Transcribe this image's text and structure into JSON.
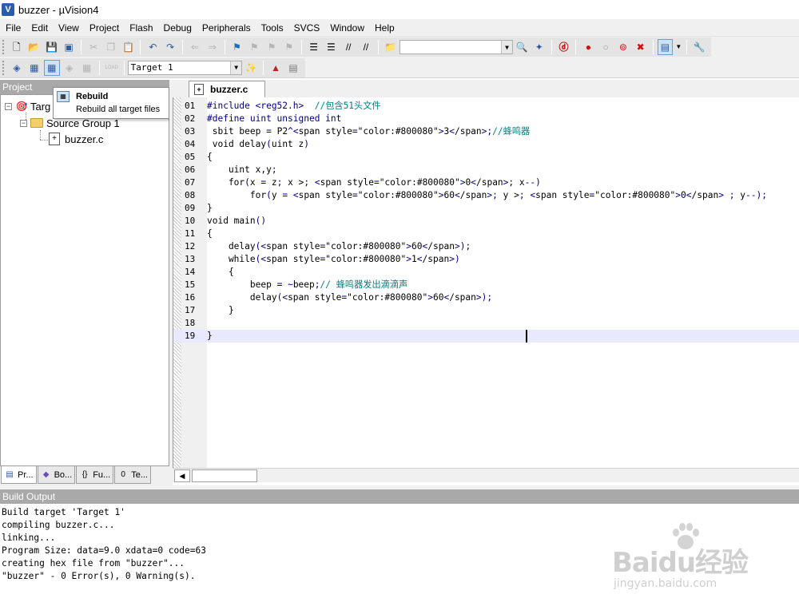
{
  "window": {
    "title": "buzzer  - µVision4"
  },
  "menu": [
    "File",
    "Edit",
    "View",
    "Project",
    "Flash",
    "Debug",
    "Peripherals",
    "Tools",
    "SVCS",
    "Window",
    "Help"
  ],
  "toolbar2": {
    "target_select": "Target 1",
    "load_label": "LOAD"
  },
  "project_panel": {
    "title": "Project",
    "target_label": "Targ",
    "group_label": "Source Group 1",
    "file_label": "buzzer.c",
    "tabs": [
      "Pr...",
      "Bo...",
      "Fu...",
      "Te..."
    ]
  },
  "tooltip": {
    "title": "Rebuild",
    "description": "Rebuild all target files"
  },
  "editor": {
    "tab_label": "buzzer.c",
    "lines": [
      {
        "no": "01",
        "code": "#include <reg52.h>  //包含51头文件"
      },
      {
        "no": "02",
        "code": "#define uint unsigned int"
      },
      {
        "no": "03",
        "code": " sbit beep = P2^3;//蜂鸣器"
      },
      {
        "no": "04",
        "code": " void delay(uint z)"
      },
      {
        "no": "05",
        "code": "{"
      },
      {
        "no": "06",
        "code": "    uint x,y;"
      },
      {
        "no": "07",
        "code": "    for(x = z; x > 0; x--)"
      },
      {
        "no": "08",
        "code": "        for(y = 60; y > 0 ; y--);"
      },
      {
        "no": "09",
        "code": "}"
      },
      {
        "no": "10",
        "code": "void main()"
      },
      {
        "no": "11",
        "code": "{"
      },
      {
        "no": "12",
        "code": "    delay(60);"
      },
      {
        "no": "13",
        "code": "    while(1)"
      },
      {
        "no": "14",
        "code": "    {"
      },
      {
        "no": "15",
        "code": "        beep = ~beep;// 蜂鸣器发出滴滴声"
      },
      {
        "no": "16",
        "code": "        delay(60);"
      },
      {
        "no": "17",
        "code": "    }"
      },
      {
        "no": "18",
        "code": ""
      },
      {
        "no": "19",
        "code": "}"
      }
    ],
    "current_line": "19"
  },
  "build_output": {
    "title": "Build Output",
    "lines": [
      "Build target 'Target 1'",
      "compiling buzzer.c...",
      "linking...",
      "Program Size: data=9.0 xdata=0 code=63",
      "creating hex file from \"buzzer\"...",
      "\"buzzer\" - 0 Error(s), 0 Warning(s)."
    ]
  },
  "watermark": {
    "brand": "Baidu经验",
    "url": "jingyan.baidu.com"
  },
  "colors": {
    "code_text": "#000000",
    "keyword": "#000080",
    "comment": "#008080",
    "number": "#800080",
    "operator": "#000080"
  }
}
